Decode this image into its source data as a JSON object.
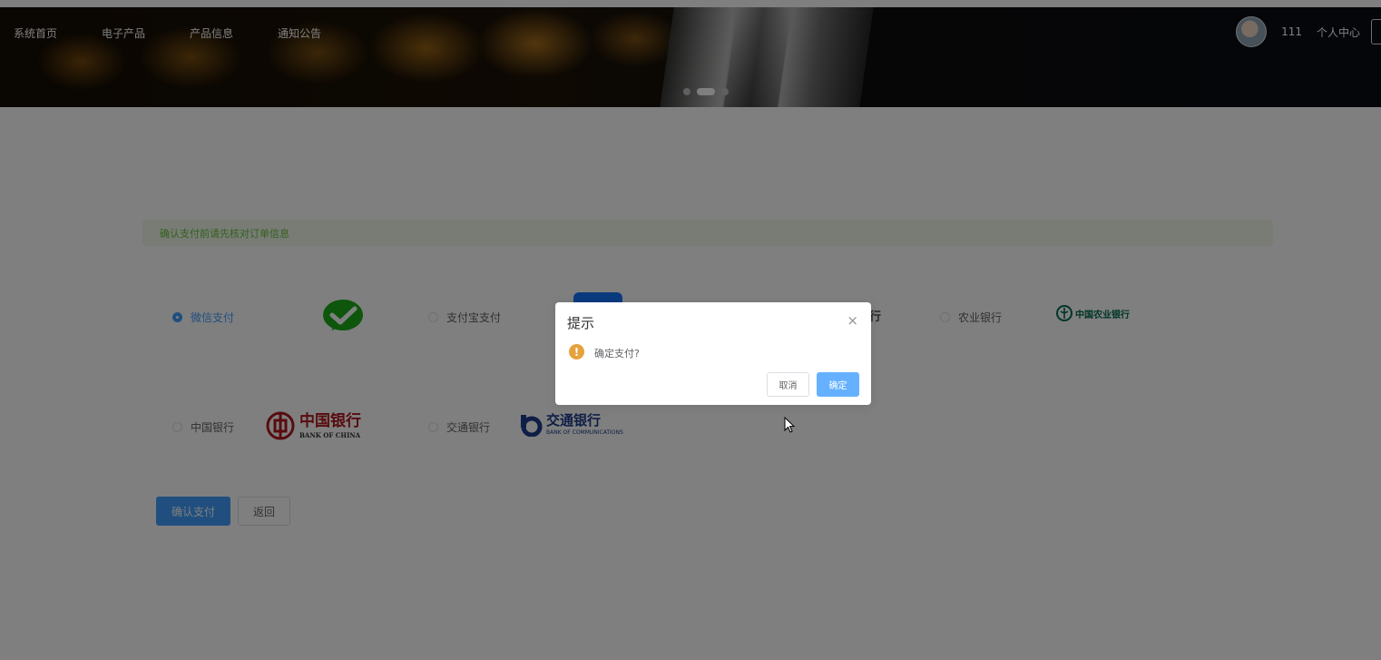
{
  "nav": {
    "items": [
      "系统首页",
      "电子产品",
      "产品信息",
      "通知公告"
    ]
  },
  "user": {
    "name": "111",
    "center_label": "个人中心"
  },
  "tip": "确认支付前请先核对订单信息",
  "payment_options": [
    {
      "label": "微信支付",
      "checked": true
    },
    {
      "label": "支付宝支付",
      "checked": false
    },
    {
      "label": "农业银行",
      "checked": false
    },
    {
      "label": "中国银行",
      "checked": false
    },
    {
      "label": "交通银行",
      "checked": false
    }
  ],
  "logos": {
    "abc": "中国农业银行",
    "boc_cn": "中国银行",
    "boc_en": "BANK OF CHINA",
    "bocom_cn": "交通银行",
    "bocom_en": "BANK OF COMMUNICATIONS",
    "partial_hidden": "行"
  },
  "actions": {
    "confirm_label": "确认支付",
    "back_label": "返回"
  },
  "dialog": {
    "title": "提示",
    "message": "确定支付?",
    "cancel_label": "取消",
    "ok_label": "确定",
    "close_glyph": "×",
    "warn_glyph": "!"
  },
  "colors": {
    "primary": "#409eff",
    "success_bg": "#f0f9eb",
    "success_text": "#67c23a",
    "warning": "#e6a23c",
    "wechat": "#1aad19",
    "boc_red": "#b0191e",
    "bocom_blue": "#1d3c8f",
    "abc_green": "#006b4f"
  },
  "icons": {
    "wechat": "wechat-logo-icon",
    "alipay": "alipay-logo-icon",
    "warning": "warning-icon",
    "close": "close-icon",
    "cursor": "mouse-cursor-icon"
  }
}
